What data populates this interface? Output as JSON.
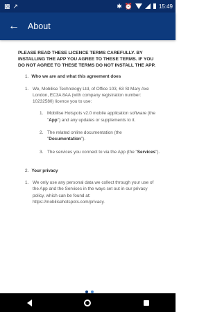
{
  "status_bar": {
    "time": "15:49"
  },
  "app_bar": {
    "title": "About"
  },
  "content": {
    "intro": "PLEASE READ THESE LICENCE TERMS CAREFULLY. BY INSTALLING THE APP YOU AGREE TO THESE TERMS. IF YOU DO NOT AGREE TO THESE TERMS DO NOT INSTALL THE APP.",
    "sections": [
      {
        "number": "1.",
        "title": "Who we are and what this agreement does",
        "items": [
          {
            "number": "1.",
            "text": "We, Mobilise Technology Ltd, of Office 103, 63 St Mary Axe London, EC3A 8AA (with company registration number: 10232580) licence you to use:"
          }
        ],
        "sub_items": [
          {
            "number": "1.",
            "before": "Mobilise Hotspots v2.0 mobile application software (the \"",
            "bold": "App",
            "after": "\") and any updates or supplements to it."
          },
          {
            "number": "2.",
            "before": "The related online documentation (the \"",
            "bold": "Documentation",
            "after": "\")."
          },
          {
            "number": "3.",
            "before": "The services you connect to via the App (the \"",
            "bold": "Services",
            "after": "\")."
          }
        ]
      },
      {
        "number": "2.",
        "title": "Your privacy",
        "items": [
          {
            "number": "1.",
            "text": "We only use any personal data we collect through your use of the App and the Services in the ways set out in our privacy policy, which can be found at: https://mobilisehotspots.com/privacy."
          }
        ]
      }
    ]
  }
}
